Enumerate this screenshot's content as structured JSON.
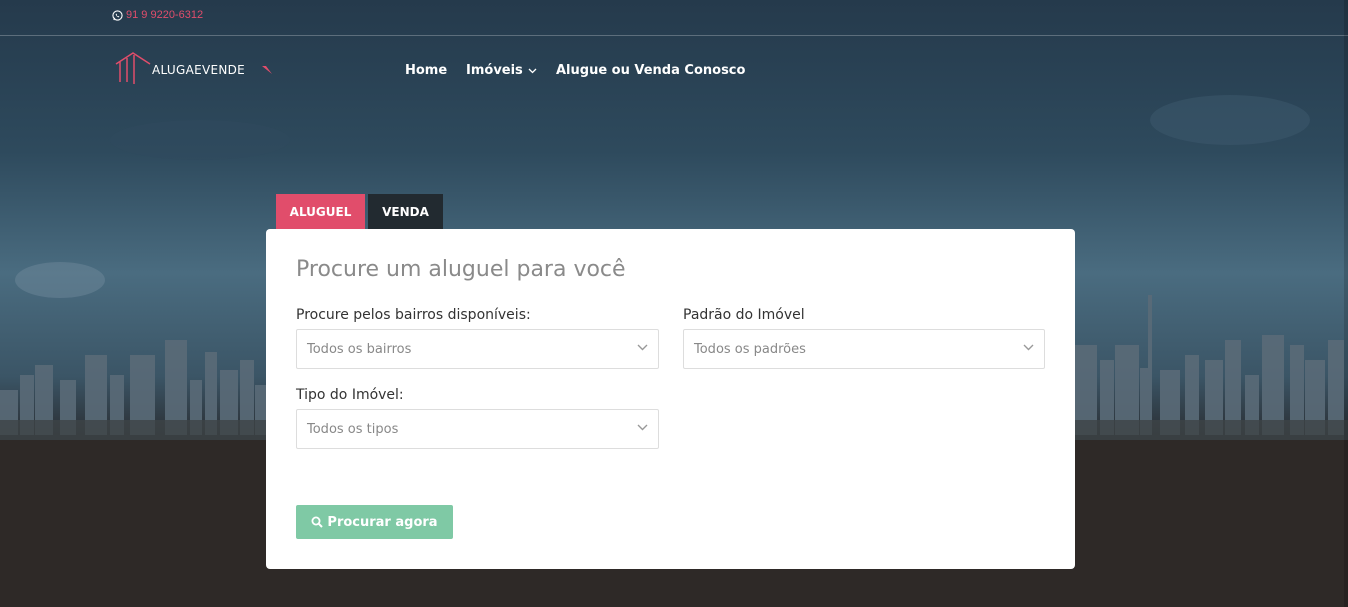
{
  "topbar": {
    "phone": "91 9 9220-6312"
  },
  "logo": {
    "text": "ALUGAEVENDE"
  },
  "nav": {
    "home": "Home",
    "imoveis": "Imóveis",
    "conosco": "Alugue ou Venda Conosco"
  },
  "tabs": {
    "rent": "ALUGUEL",
    "sale": "VENDA"
  },
  "search": {
    "title": "Procure um aluguel para você",
    "bairro_label": "Procure pelos bairros disponíveis:",
    "bairro_value": "Todos os bairros",
    "padrao_label": "Padrão do Imóvel",
    "padrao_value": "Todos os padrões",
    "tipo_label": "Tipo do Imóvel:",
    "tipo_value": "Todos os tipos",
    "button": "Procurar agora"
  },
  "colors": {
    "accent": "#e14d6b",
    "dark_tab": "#222a30",
    "button": "#7fc9a5"
  }
}
